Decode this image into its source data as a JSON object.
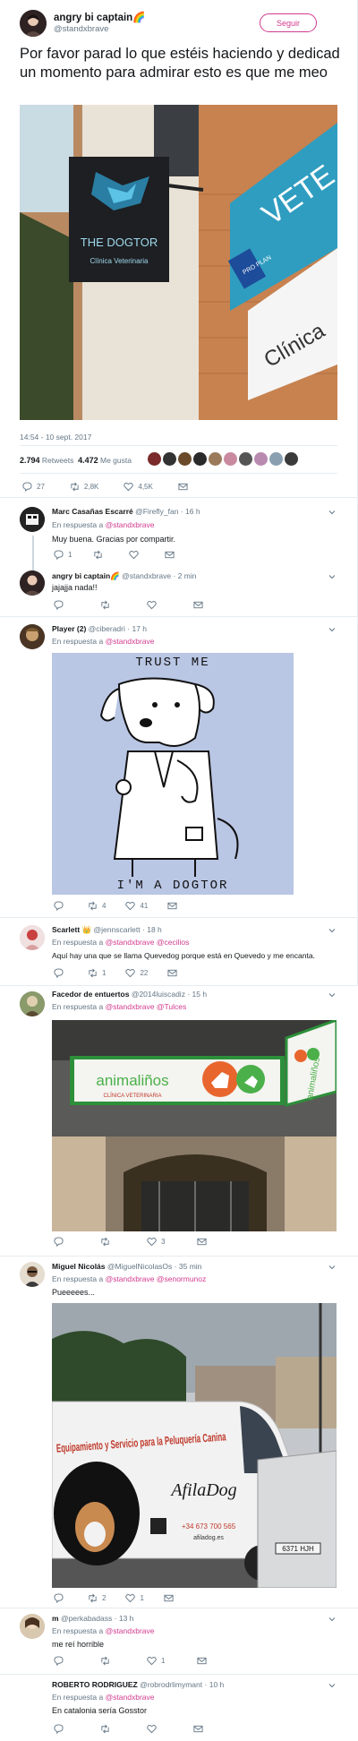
{
  "main_tweet": {
    "display_name": "angry bi captain🌈",
    "handle": "@standxbrave",
    "follow_label": "Seguir",
    "text": "Por favor parad lo que estéis haciendo y dedicad un momento para admirar esto es que me meo",
    "photo": {
      "sign_title": "THE DOGTOR",
      "sign_subtitle": "Clínica Veterinaria",
      "side_sign": "VETE",
      "side_sub": "Clínica",
      "plan_badge": "PRO PLAN"
    },
    "timestamp": "14:54 - 10 sept. 2017",
    "retweets_count": "2.794",
    "retweets_label": "Retweets",
    "likes_count": "4.472",
    "likes_label": "Me gusta",
    "actions": {
      "reply": "27",
      "retweet": "2,8K",
      "like": "4,5K"
    }
  },
  "replies": [
    {
      "name": "Marc Casañas Escarré",
      "handle": "@Firefly_fan",
      "time": "16 h",
      "to_label": "En respuesta a",
      "to": "@standxbrave",
      "text": "Muy buena. Gracias por compartir.",
      "counts": {
        "reply": "1",
        "retweet": "",
        "like": ""
      }
    },
    {
      "name": "angry bi captain🌈",
      "handle": "@standxbrave",
      "time": "2 min",
      "text": "jajajja nada!!",
      "counts": {
        "reply": "",
        "retweet": "",
        "like": ""
      }
    },
    {
      "name": "Player (2)",
      "handle": "@ciberadri",
      "time": "17 h",
      "to_label": "En respuesta a",
      "to": "@standxbrave",
      "image": {
        "top_text": "TRUST ME",
        "bottom_text": "I'M A DOGTOR"
      },
      "counts": {
        "reply": "",
        "retweet": "4",
        "like": "41"
      }
    },
    {
      "name": "Scarlett 👑",
      "handle": "@jennscarlett",
      "time": "18 h",
      "to_label": "En respuesta a",
      "to": "@standxbrave @cecilios",
      "text": "Aquí hay una que se llama Quevedog porque está en Quevedo y me encanta.",
      "counts": {
        "reply": "",
        "retweet": "1",
        "like": "22"
      }
    },
    {
      "name": "Facedor de entuertos",
      "handle": "@2014luiscadiz",
      "time": "15 h",
      "to_label": "En respuesta a",
      "to": "@standxbrave @Tulces",
      "image": {
        "sign_text": "animaliños",
        "sign_sub": "CLÍNICA VETERINARIA",
        "side_text": "animaliños"
      },
      "counts": {
        "reply": "",
        "retweet": "",
        "like": "3"
      }
    },
    {
      "name": "Miguel Nicolás",
      "handle": "@MiguelNicolasOs",
      "time": "35 min",
      "to_label": "En respuesta a",
      "to": "@standxbrave @senormunoz",
      "text": "Pueeeees...",
      "image": {
        "van_text": "Equipamiento y Servicio para la Peluquería Canina",
        "brand": "AfilaDog",
        "phone": "+34 673 700 565",
        "web": "afiladog.es",
        "plate": "6371 HJH"
      },
      "counts": {
        "reply": "",
        "retweet": "2",
        "like": "1"
      }
    },
    {
      "name": "m",
      "handle": "@perkabadass",
      "time": "13 h",
      "to_label": "En respuesta a",
      "to": "@standxbrave",
      "text": "me reí horrible",
      "counts": {
        "reply": "",
        "retweet": "",
        "like": "1"
      }
    },
    {
      "name": "ROBERTO RODRIGUEZ",
      "handle": "@robrodrlimymant",
      "time": "10 h",
      "to_label": "En respuesta a",
      "to": "@standxbrave",
      "text": "En catalonia sería Gosstor",
      "counts": {
        "reply": "",
        "retweet": "",
        "like": ""
      }
    }
  ],
  "colors": {
    "accent": "#d23b8f",
    "muted": "#657786",
    "text": "#14171a",
    "sign_teal": "#3fa9c6"
  }
}
